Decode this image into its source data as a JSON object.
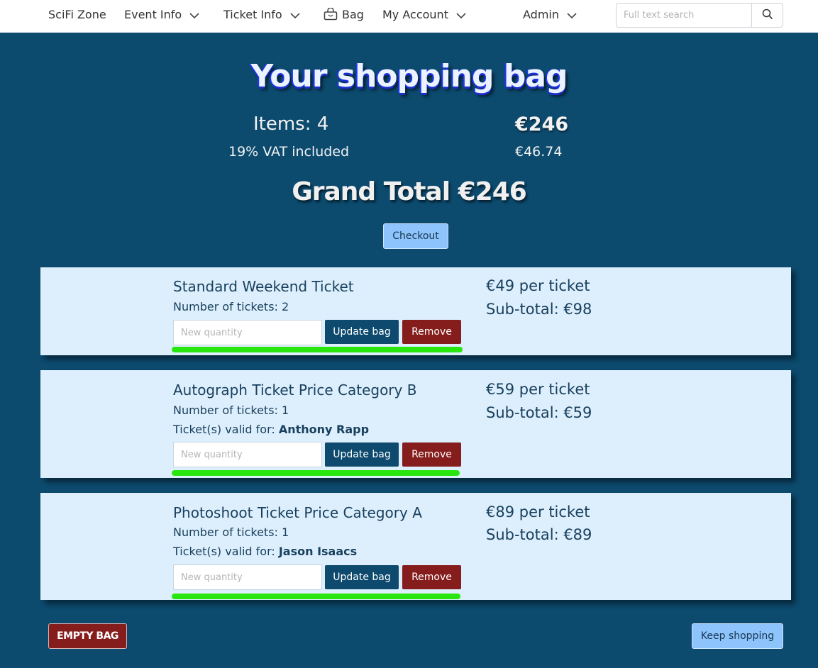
{
  "nav": {
    "brand": "SciFi Zone",
    "event_info": "Event Info",
    "ticket_info": "Ticket Info",
    "bag": "Bag",
    "my_account": "My Account",
    "admin": "Admin",
    "search_placeholder": "Full text search"
  },
  "header": {
    "title": "Your shopping bag",
    "items_label": "Items: 4",
    "items_total": "€246",
    "vat_label": "19% VAT included",
    "vat_amount": "€46.74",
    "grand_total": "Grand Total €246",
    "checkout_label": "Checkout"
  },
  "items": [
    {
      "name": "Standard Weekend Ticket",
      "count_text": "Number of tickets: 2",
      "unit_price": "€49 per ticket",
      "subtotal": "Sub-total: €98",
      "qty_placeholder": "New quantity",
      "update_label": "Update bag",
      "remove_label": "Remove"
    },
    {
      "name": "Autograph Ticket Price Category B",
      "count_text": "Number of tickets: 1",
      "valid_prefix": "Ticket(s) valid for: ",
      "valid_for": "Anthony Rapp",
      "unit_price": "€59 per ticket",
      "subtotal": "Sub-total: €59",
      "qty_placeholder": "New quantity",
      "update_label": "Update bag",
      "remove_label": "Remove"
    },
    {
      "name": "Photoshoot Ticket Price Category A",
      "count_text": "Number of tickets: 1",
      "valid_prefix": "Ticket(s) valid for: ",
      "valid_for": "Jason Isaacs",
      "unit_price": "€89 per ticket",
      "subtotal": "Sub-total: €89",
      "qty_placeholder": "New quantity",
      "update_label": "Update bag",
      "remove_label": "Remove"
    }
  ],
  "footer": {
    "empty_label": "EMPTY BAG",
    "keep_label": "Keep shopping"
  },
  "colors": {
    "page_bg": "#0c4a6e",
    "card_bg": "#ddeffd",
    "update_button": "#0d4a6e",
    "remove_button": "#861d1d",
    "light_button": "#8cc4fb",
    "green_bar": "#29e60f"
  },
  "icons": {
    "bag": "shopping-bag-icon",
    "search": "search-icon",
    "dropdown": "chevron-down-icon"
  }
}
